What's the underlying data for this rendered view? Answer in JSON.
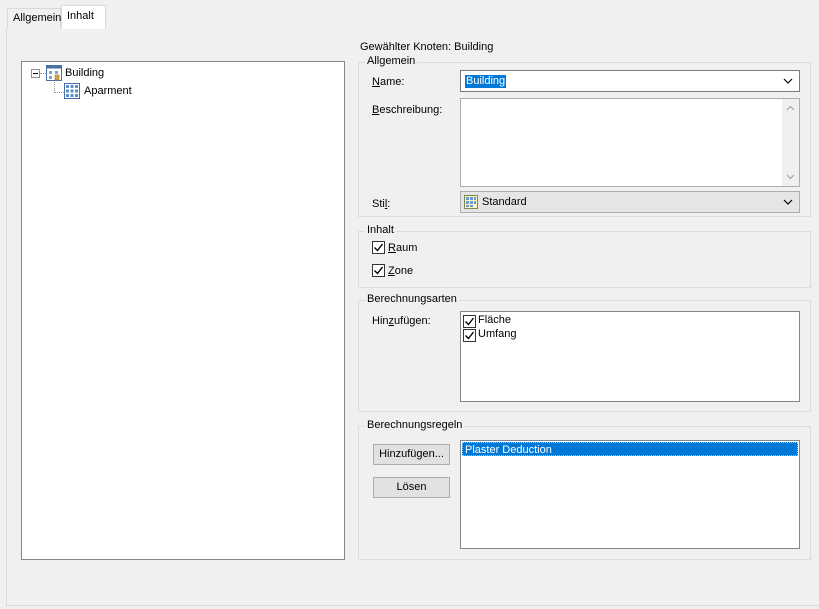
{
  "tabs": [
    {
      "label": "Allgemein"
    },
    {
      "label": "Inhalt"
    }
  ],
  "tree": {
    "root": {
      "label": "Building",
      "icon": "building-icon"
    },
    "children": [
      {
        "label": "Aparment",
        "icon": "space-icon"
      }
    ]
  },
  "selected_node": {
    "text": "Gewählter Knoten: Building"
  },
  "allgemein": {
    "title": "Allgemein",
    "name_label": "Name:",
    "name_value": "Building",
    "beschreibung_label": "Beschreibung:",
    "beschreibung_value": "",
    "stil_label": "Stil:",
    "stil_value": "Standard",
    "stil_icon": "style-grid-icon"
  },
  "inhalt": {
    "title": "Inhalt",
    "raum_label": "Raum",
    "raum_checked": true,
    "zone_label": "Zone",
    "zone_checked": true
  },
  "berechnungsarten": {
    "title": "Berechnungsarten",
    "hinzufuegen_label": "Hinzufügen:",
    "items": [
      {
        "label": "Fläche",
        "checked": true
      },
      {
        "label": "Umfang",
        "checked": true
      }
    ]
  },
  "berechnungsregeln": {
    "title": "Berechnungsregeln",
    "add_button": "Hinzufügen...",
    "remove_button": "Lösen",
    "items": [
      {
        "label": "Plaster Deduction",
        "selected": true
      }
    ]
  },
  "colors": {
    "selection": "#0078d7",
    "window_bg": "#f0f0f0",
    "border": "#dcdcdc"
  }
}
